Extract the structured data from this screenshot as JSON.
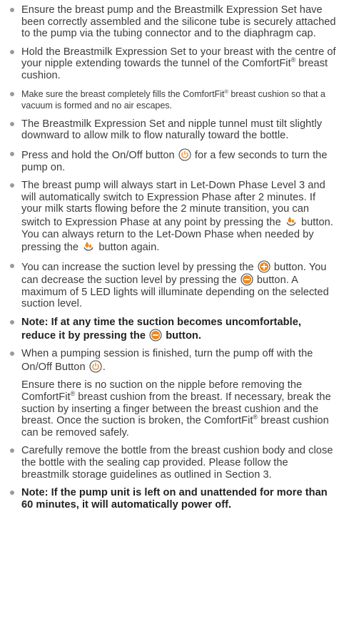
{
  "instructions": {
    "i1": "Ensure the breast pump and the Breastmilk Expression Set have been correctly assembled and the silicone tube is securely attached to the pump via the tubing connector and to the diaphragm cap.",
    "i2a": "Hold the Breastmilk Expression Set to your breast with the centre of your nipple extending towards the tunnel of the ComfortFit",
    "i2b": " breast cushion.",
    "i3a": "Make sure the breast completely fills the ComfortFit",
    "i3b": " breast cushion so that a vacuum is formed and no air escapes.",
    "i4": "The Breastmilk Expression Set and nipple tunnel must tilt slightly downward to allow milk to flow naturally toward the bottle.",
    "i5a": "Press and hold the On/Off button ",
    "i5b": " for a few seconds to turn the pump on.",
    "i6a": "The breast pump will always start in Let-Down Phase Level 3 and will automatically switch to Expression Phase after 2 minutes. If your milk starts flowing before the 2 minute transition, you can switch to Expression Phase at any point by pressing the ",
    "i6b": " button. You can always return to the Let-Down Phase when needed by pressing the ",
    "i6c": " button again.",
    "i7a": "You can increase the suction level by pressing the ",
    "i7b": " button. You can decrease the suction level by pressing the ",
    "i7c": " button. A maximum of 5 LED lights will illuminate depending on the selected suction level.",
    "i8a": "Note: If at any time the suction becomes uncomfortable, reduce it by pressing the ",
    "i8b": " button.",
    "i9a": "When a pumping session is finished, turn the pump off with the On/Off Button ",
    "i9b": ".",
    "p1a": "Ensure there is no suction on the nipple before removing the ComfortFit",
    "p1b": " breast cushion from the breast. If necessary, break the suction by inserting a finger between the breast cushion and the breast. Once the suction is broken, the ComfortFit",
    "p1c": " breast cushion can be removed safely.",
    "i10": "Carefully remove the bottle from the breast cushion body and close the bottle with the sealing cap provided. Please follow the breastmilk storage guidelines as outlined in Section 3.",
    "i11": "Note: If the pump unit is left on and unattended for more than 60 minutes, it will automatically power off.",
    "reg": "®"
  },
  "icons": {
    "power": "power-icon",
    "phase": "droplets-phase-icon",
    "plus": "plus-circle-icon",
    "minus": "minus-circle-icon"
  },
  "colors": {
    "text": "#3b3b3b",
    "bullet": "#9a9a9a",
    "icon_orange": "#f08a1c"
  }
}
